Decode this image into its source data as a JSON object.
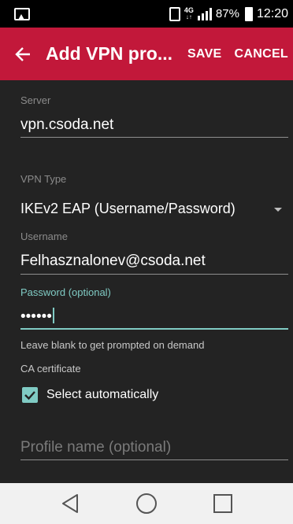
{
  "status_bar": {
    "network_label": "4G",
    "battery": "87%",
    "time": "12:20"
  },
  "app_bar": {
    "title": "Add VPN pro...",
    "save_label": "SAVE",
    "cancel_label": "CANCEL",
    "color": "#c2183a"
  },
  "form": {
    "server": {
      "label": "Server",
      "value": "vpn.csoda.net"
    },
    "vpn_type": {
      "label": "VPN Type",
      "value": "IKEv2 EAP (Username/Password)"
    },
    "username": {
      "label": "Username",
      "value": "Felhasznalonev@csoda.net"
    },
    "password": {
      "label": "Password (optional)",
      "value": "••••••",
      "hint": "Leave blank to get prompted on demand"
    },
    "ca_certificate": {
      "label": "CA certificate",
      "checkbox_label": "Select automatically",
      "checked": true
    },
    "profile_name": {
      "placeholder": "Profile name (optional)",
      "value": ""
    },
    "accent_color": "#80cbc4"
  },
  "nav_bar": {
    "icons": [
      "back-icon",
      "home-icon",
      "recents-icon"
    ]
  }
}
